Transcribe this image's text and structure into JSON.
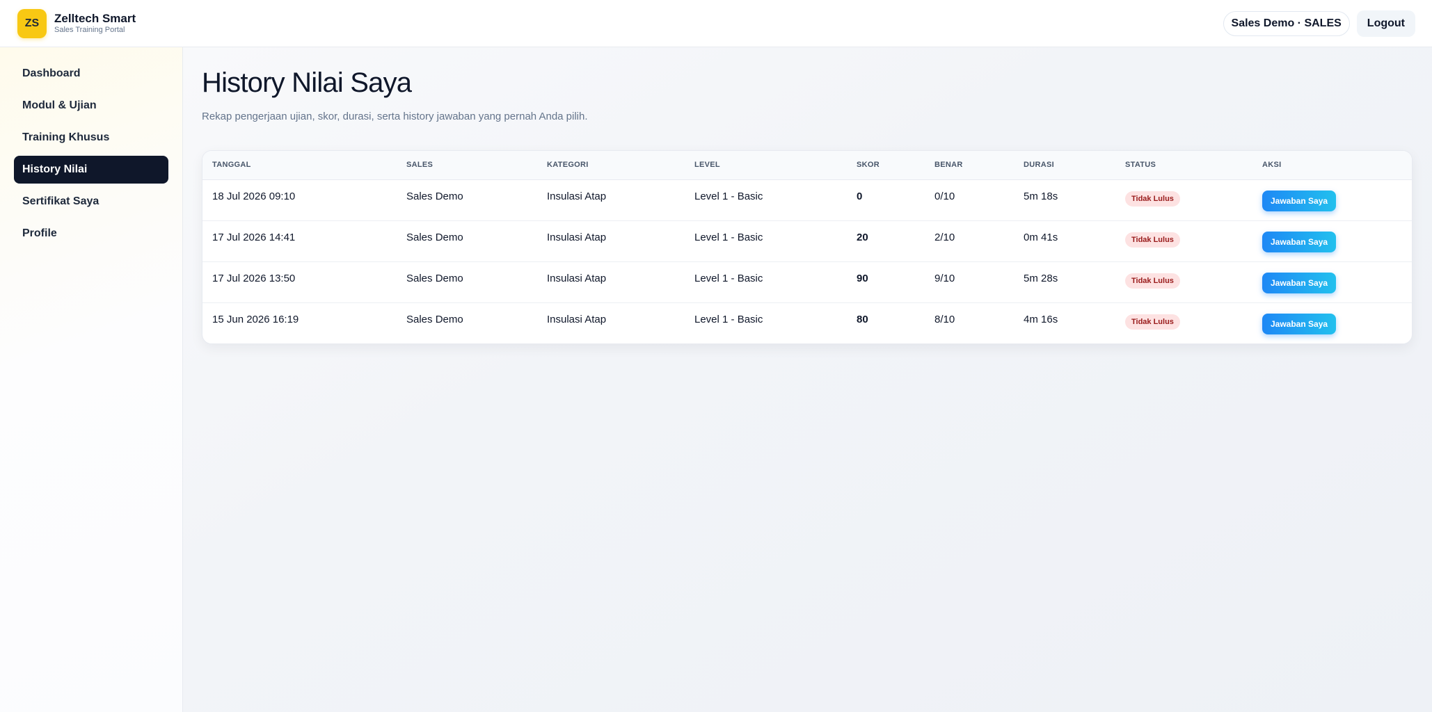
{
  "app": {
    "logo_initials": "ZS",
    "name": "Zelltech Smart",
    "subtitle": "Sales Training Portal"
  },
  "header": {
    "user_label": "Sales Demo · SALES",
    "logout_label": "Logout"
  },
  "sidebar": {
    "items": [
      {
        "label": "Dashboard",
        "active": false
      },
      {
        "label": "Modul & Ujian",
        "active": false
      },
      {
        "label": "Training Khusus",
        "active": false
      },
      {
        "label": "History Nilai",
        "active": true
      },
      {
        "label": "Sertifikat Saya",
        "active": false
      },
      {
        "label": "Profile",
        "active": false
      }
    ]
  },
  "main": {
    "title": "History Nilai Saya",
    "subtitle": "Rekap pengerjaan ujian, skor, durasi, serta history jawaban yang pernah Anda pilih."
  },
  "table": {
    "columns": [
      "TANGGAL",
      "SALES",
      "KATEGORI",
      "LEVEL",
      "SKOR",
      "BENAR",
      "DURASI",
      "STATUS",
      "AKSI"
    ],
    "rows": [
      {
        "tanggal": "18 Jul 2026 09:10",
        "sales": "Sales Demo",
        "kategori": "Insulasi Atap",
        "level": "Level 1 - Basic",
        "skor": "0",
        "benar": "0/10",
        "durasi": "5m 18s",
        "status": "Tidak Lulus",
        "aksi": "Jawaban Saya"
      },
      {
        "tanggal": "17 Jul 2026 14:41",
        "sales": "Sales Demo",
        "kategori": "Insulasi Atap",
        "level": "Level 1 - Basic",
        "skor": "20",
        "benar": "2/10",
        "durasi": "0m 41s",
        "status": "Tidak Lulus",
        "aksi": "Jawaban Saya"
      },
      {
        "tanggal": "17 Jul 2026 13:50",
        "sales": "Sales Demo",
        "kategori": "Insulasi Atap",
        "level": "Level 1 - Basic",
        "skor": "90",
        "benar": "9/10",
        "durasi": "5m 28s",
        "status": "Tidak Lulus",
        "aksi": "Jawaban Saya"
      },
      {
        "tanggal": "15 Jun 2026 16:19",
        "sales": "Sales Demo",
        "kategori": "Insulasi Atap",
        "level": "Level 1 - Basic",
        "skor": "80",
        "benar": "8/10",
        "durasi": "4m 16s",
        "status": "Tidak Lulus",
        "aksi": "Jawaban Saya"
      }
    ]
  },
  "colors": {
    "accent_dark": "#0f172a",
    "logo_yellow": "#f8c813",
    "badge_bg": "#fde2e2",
    "badge_text": "#991b1b",
    "button_gradient_start": "#1e88f5",
    "button_gradient_end": "#22c0ee"
  }
}
